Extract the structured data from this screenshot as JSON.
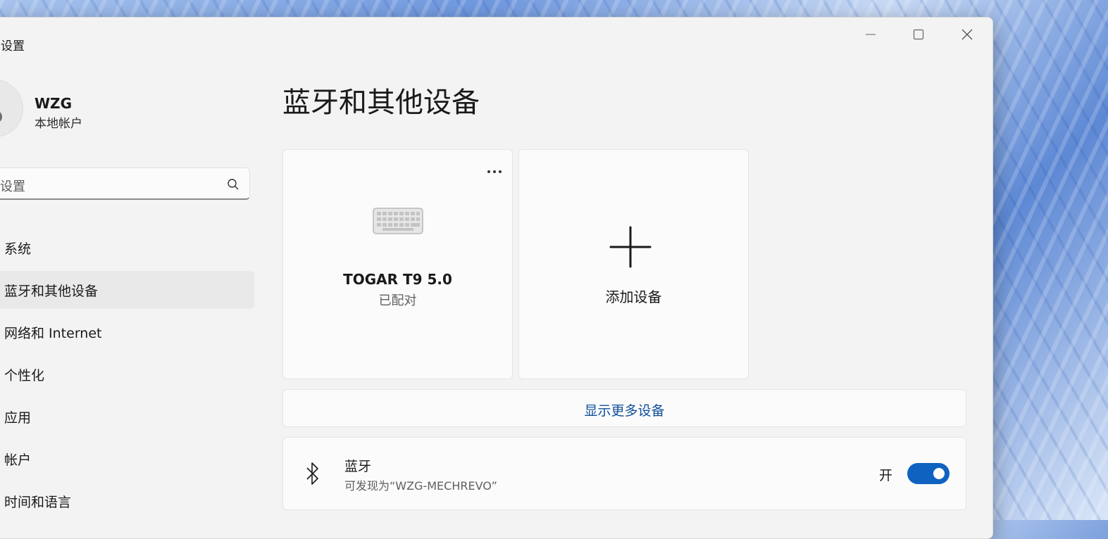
{
  "window": {
    "title": "设置"
  },
  "user": {
    "name": "WZG",
    "account_type": "本地帐户"
  },
  "search": {
    "placeholder": "设置"
  },
  "nav": {
    "items": [
      {
        "label": "系统",
        "selected": false
      },
      {
        "label": "蓝牙和其他设备",
        "selected": true
      },
      {
        "label": "网络和 Internet",
        "selected": false
      },
      {
        "label": "个性化",
        "selected": false
      },
      {
        "label": "应用",
        "selected": false
      },
      {
        "label": "帐户",
        "selected": false
      },
      {
        "label": "时间和语言",
        "selected": false
      }
    ]
  },
  "page": {
    "title": "蓝牙和其他设备"
  },
  "devices": [
    {
      "name": "TOGAR T9 5.0",
      "status": "已配对",
      "icon": "keyboard-icon"
    }
  ],
  "add_device": {
    "label": "添加设备",
    "icon": "plus-icon"
  },
  "show_more": {
    "label": "显示更多设备"
  },
  "bluetooth": {
    "title": "蓝牙",
    "subtitle": "可发现为“WZG-MECHREVO”",
    "state_label": "开",
    "enabled": true,
    "icon": "bluetooth-icon"
  },
  "colors": {
    "accent": "#0f62c0",
    "link": "#0f4f9a"
  }
}
